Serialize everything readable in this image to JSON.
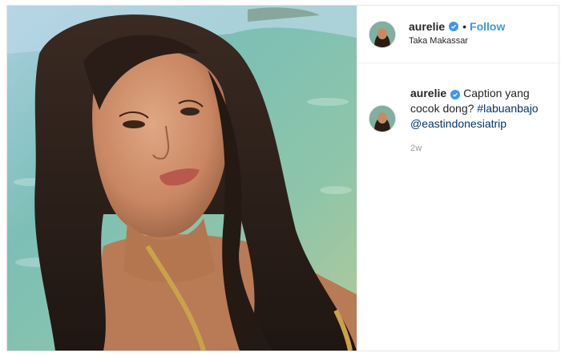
{
  "post": {
    "username": "aurelie",
    "follow_label": "Follow",
    "separator": "•",
    "location": "Taka Makassar",
    "icons": {
      "verified": "verified-badge-icon",
      "avatar": "profile-avatar"
    },
    "accent_color": "#3897f0"
  },
  "caption": {
    "username": "aurelie",
    "text": "Caption yang cocok dong?",
    "hashtag": "#labuanbajo",
    "mention": "@eastindonesiatrip",
    "timestamp": "2w"
  }
}
